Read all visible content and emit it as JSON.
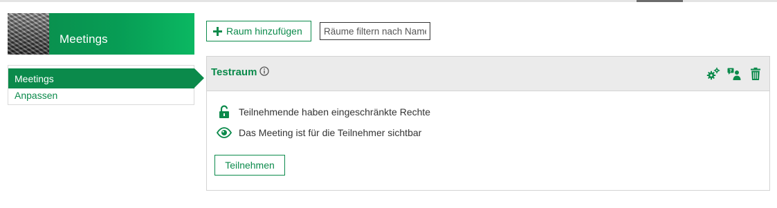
{
  "banner": {
    "title": "Meetings"
  },
  "sidebar": {
    "items": [
      {
        "label": "Meetings",
        "active": true
      },
      {
        "label": "Anpassen",
        "active": false
      }
    ]
  },
  "toolbar": {
    "add_room_label": "Raum hinzufügen",
    "filter_placeholder": "Räume filtern nach Name"
  },
  "room": {
    "title": "Testraum",
    "rows": [
      {
        "icon": "lock-open-icon",
        "text": "Teilnehmende haben eingeschränkte Rechte"
      },
      {
        "icon": "eye-icon",
        "text": "Das Meeting ist für die Teilnehmer sichtbar"
      }
    ],
    "join_label": "Teilnehmen"
  },
  "colors": {
    "accent": "#0b8a4b",
    "header_bg": "#ebebeb",
    "border": "#d3d3d3"
  }
}
